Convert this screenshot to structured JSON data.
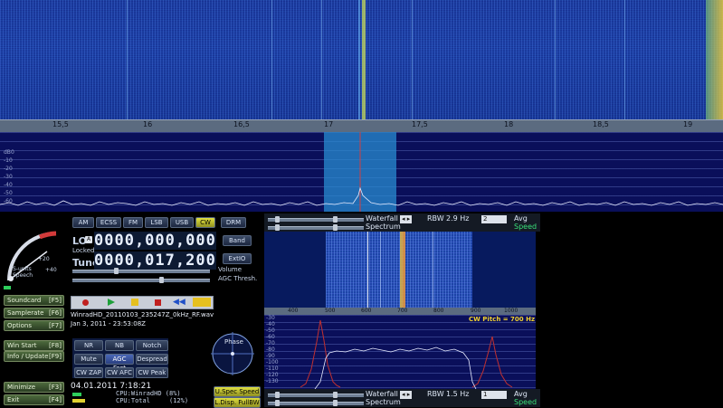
{
  "main_axis": {
    "ticks": [
      "15,5",
      "16",
      "16,5",
      "17",
      "17,5",
      "18",
      "18,5",
      "19"
    ]
  },
  "db_scale": [
    "0",
    "-10",
    "-20",
    "-30",
    "-40",
    "-50",
    "-60"
  ],
  "db_unit": "dB",
  "modes": [
    "AM",
    "ECSS",
    "FM",
    "LSB",
    "USB",
    "CW",
    "DRM"
  ],
  "active_mode": "CW",
  "smeter": {
    "label": "S-units\nSpeech",
    "plus20": "+20",
    "plus40": "+40"
  },
  "lo": {
    "label": "LO",
    "locked": "Locked",
    "value": "0000,000,000"
  },
  "tune": {
    "label": "Tune",
    "value": "0000,017,200"
  },
  "buttons": {
    "band": "Band",
    "extio": "ExtIO"
  },
  "labels": {
    "volume": "Volume",
    "agc_thresh": "AGC Thresh."
  },
  "side_buttons": [
    {
      "label": "Soundcard",
      "key": "[F5]"
    },
    {
      "label": "Samplerate",
      "key": "[F6]"
    },
    {
      "label": "Options",
      "key": "[F7]"
    },
    {
      "label": "Win Start",
      "key": "[F8]"
    },
    {
      "label": "Info / Update",
      "key": "[F9]"
    },
    {
      "label": "Minimize",
      "key": "[F3]"
    },
    {
      "label": "Exit",
      "key": "[F4]"
    }
  ],
  "file": {
    "name": "WinradHD_20110103_235247Z_0kHz_RF.wav",
    "date": "Jan 3, 2011 - 23:53:08Z"
  },
  "dsp_buttons": [
    [
      "NR",
      "NB",
      "Notch"
    ],
    [
      "Mute",
      "AGC Fast",
      "Despread"
    ],
    [
      "CW ZAP",
      "CW AFC",
      "CW Peak"
    ]
  ],
  "active_dsp": "AGC Fast",
  "phase_label": "Phase",
  "clock": "04.01.2011 7:18:21",
  "cpu": {
    "winrad": "CPU:WinradHD (8%)",
    "total": "CPU:Total     (12%)"
  },
  "bottom_buttons": {
    "uspec": "U.Spec Speed",
    "ldisp": "L.Disp. FullBW"
  },
  "top_controls": {
    "waterfall": "Waterfall",
    "spectrum": "Spectrum",
    "rbw": "RBW",
    "rbw_value": "2.9 Hz",
    "avg_value": "2",
    "avg": "Avg",
    "speed": "Speed"
  },
  "bottom_controls": {
    "waterfall": "Waterfall",
    "spectrum": "Spectrum",
    "rbw": "RBW",
    "rbw_value": "1.5 Hz",
    "avg_value": "1",
    "avg": "Avg",
    "speed": "Speed"
  },
  "sub_axis": {
    "ticks": [
      "400",
      "500",
      "600",
      "700",
      "800",
      "900",
      "1000"
    ]
  },
  "sub_db": [
    "-30",
    "-40",
    "-50",
    "-60",
    "-70",
    "-80",
    "-90",
    "-100",
    "-110",
    "-120",
    "-130"
  ],
  "cw_pitch": "CW Pitch = 700 Hz",
  "colors": {
    "accent": "#2a63d8",
    "cw_active": "#e0e040",
    "spectrum_line": "#ffffff",
    "cw_peak": "#c03030"
  }
}
